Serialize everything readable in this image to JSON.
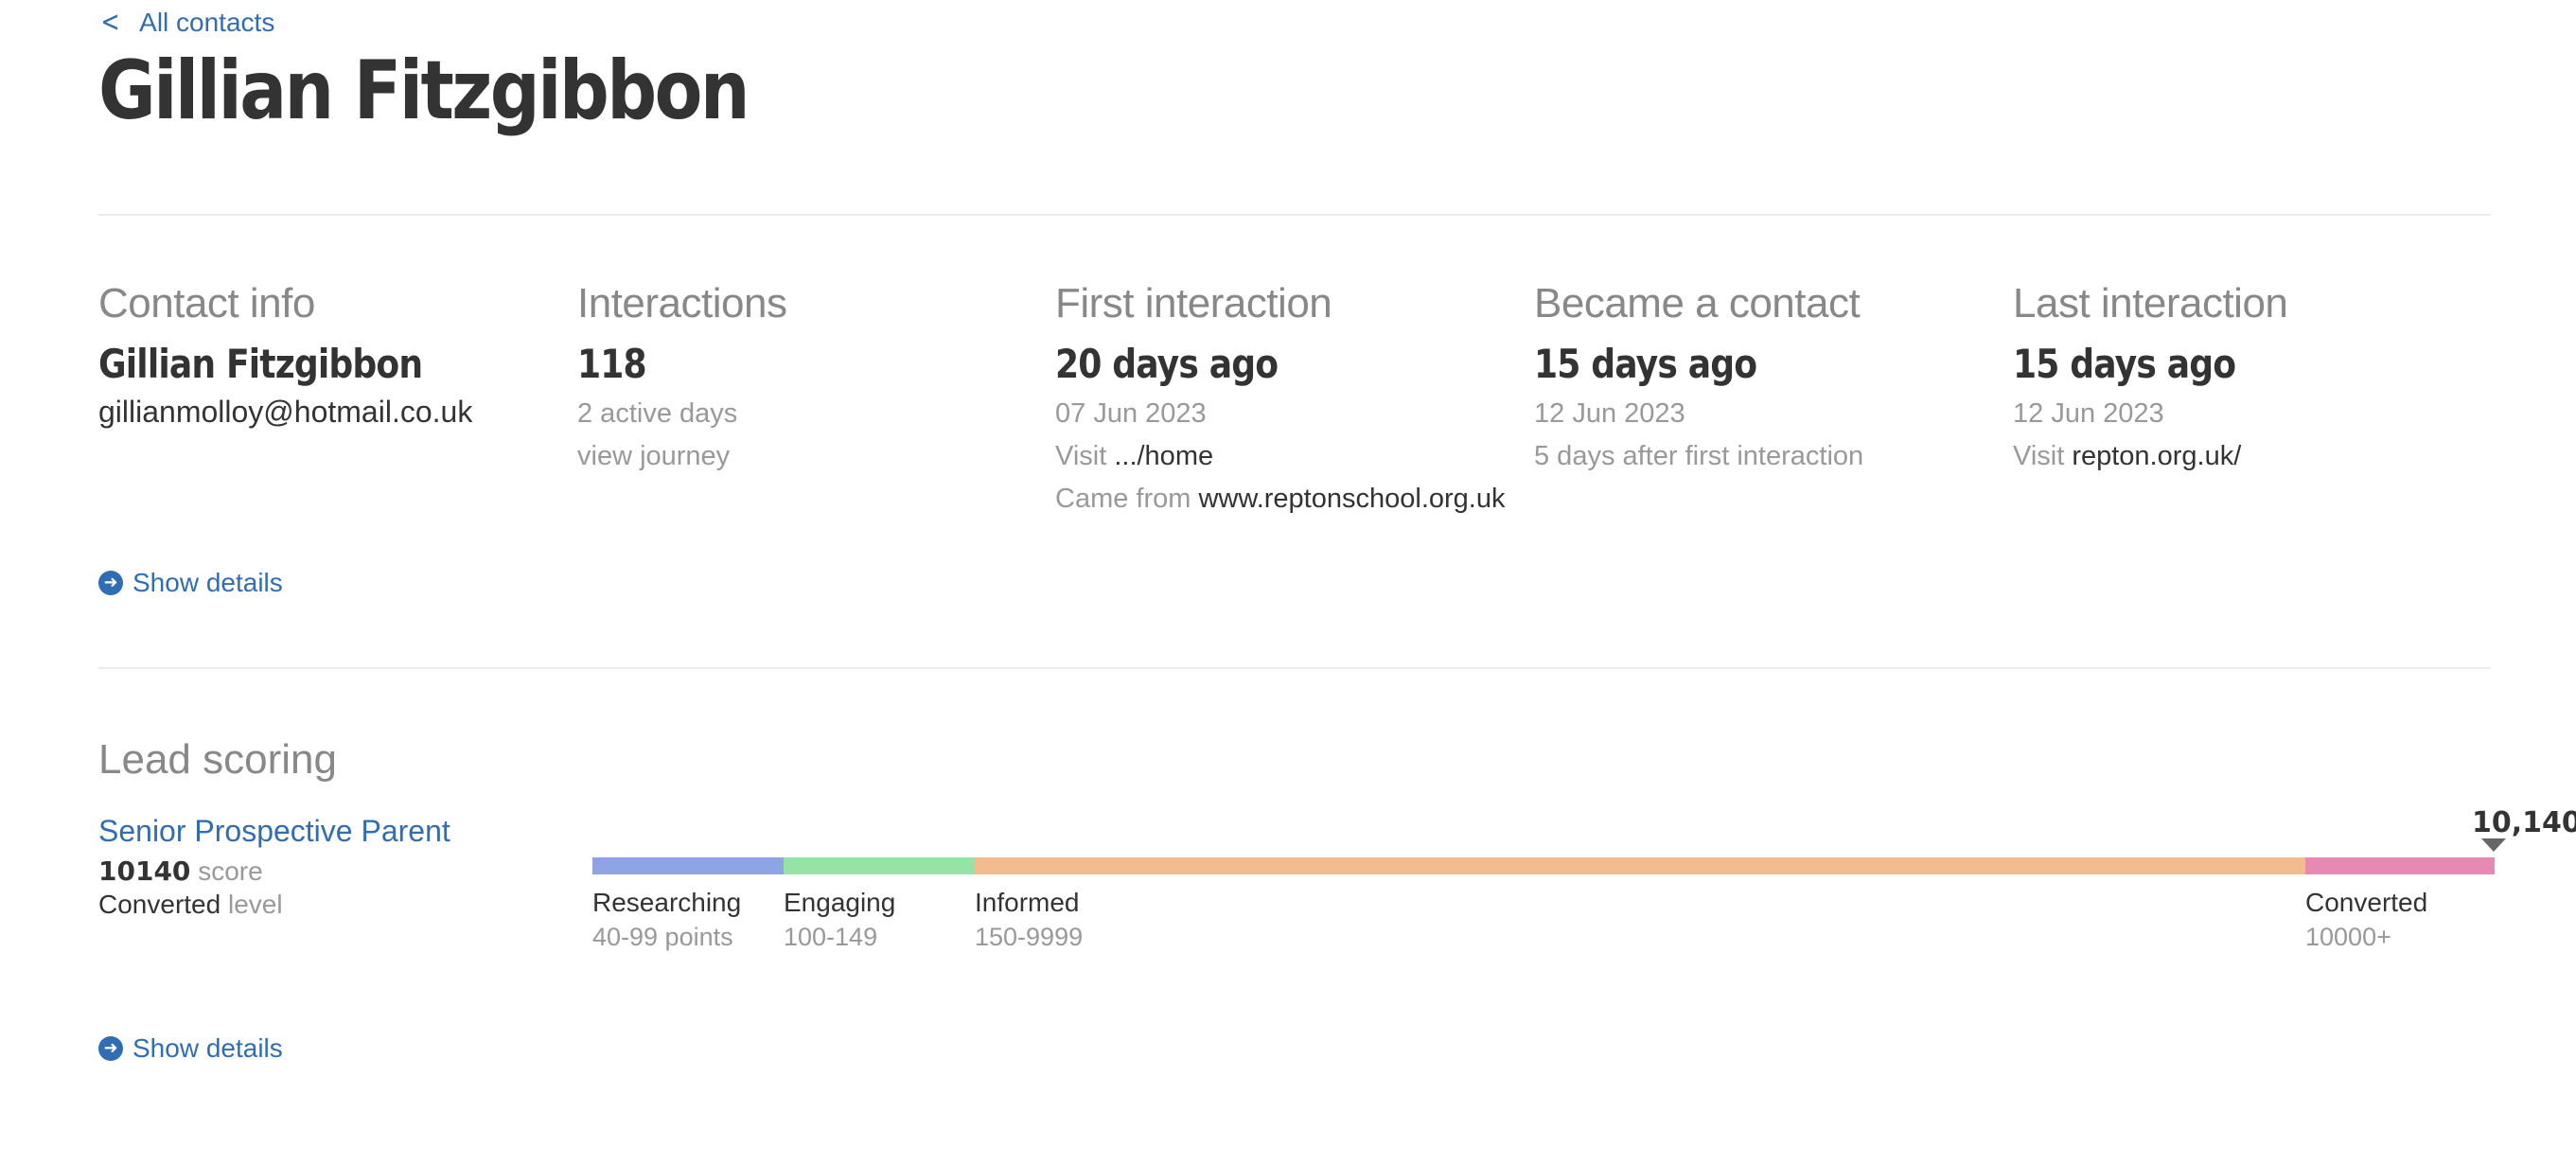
{
  "nav": {
    "back_label": "All contacts"
  },
  "contact": {
    "name": "Gillian Fitzgibbon"
  },
  "columns": {
    "contact_info": {
      "heading": "Contact info",
      "name": "Gillian Fitzgibbon",
      "email": "gillianmolloy@hotmail.co.uk"
    },
    "interactions": {
      "heading": "Interactions",
      "count": "118",
      "active_days": "2 active days",
      "journey_link": "view journey"
    },
    "first_interaction": {
      "heading": "First interaction",
      "relative": "20 days ago",
      "date": "07 Jun 2023",
      "visit_prefix": "Visit",
      "visit_value": ".../home",
      "came_from_prefix": "Came from",
      "came_from_value": "www.reptonschool.org.uk"
    },
    "became_contact": {
      "heading": "Became a contact",
      "relative": "15 days ago",
      "date": "12 Jun 2023",
      "after_first": "5 days after first interaction"
    },
    "last_interaction": {
      "heading": "Last interaction",
      "relative": "15 days ago",
      "date": "12 Jun 2023",
      "visit_prefix": "Visit",
      "visit_value": "repton.org.uk/"
    }
  },
  "details_toggle": {
    "label": "Show details"
  },
  "lead_scoring": {
    "heading": "Lead scoring",
    "profile_name": "Senior Prospective Parent",
    "score": "10140",
    "score_suffix": "score",
    "level": "Converted",
    "level_suffix": "level",
    "marker_value": "10,140",
    "segments": [
      {
        "label": "Researching",
        "range": "40-99 points",
        "color": "#8fa4e4"
      },
      {
        "label": "Engaging",
        "range": "100-149",
        "color": "#95e3a6"
      },
      {
        "label": "Informed",
        "range": "150-9999",
        "color": "#f3bc8e"
      },
      {
        "label": "Converted",
        "range": "10000+",
        "color": "#e689b3"
      }
    ]
  }
}
